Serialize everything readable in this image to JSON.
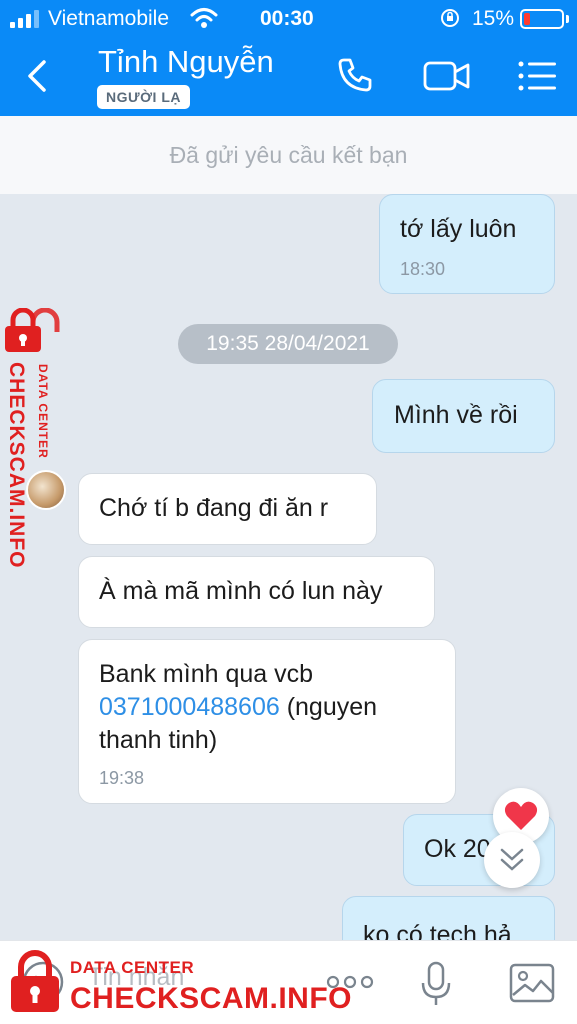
{
  "status_bar": {
    "carrier": "Vietnamobile",
    "time": "00:30",
    "battery": "15%"
  },
  "header": {
    "name": "Tỉnh Nguyễn",
    "badge": "NGƯỜI LẠ"
  },
  "friend_request": "Đã gửi yêu cầu kết bạn",
  "messages": {
    "m1": {
      "text": "tớ lấy luôn",
      "time": "18:30"
    },
    "separator": "19:35 28/04/2021",
    "m2": {
      "text": "Mình về rồi"
    },
    "m3": {
      "text": "Chớ tí b đang đi ăn r"
    },
    "m4": {
      "text": "À mà mã mình có lun này"
    },
    "m5": {
      "line1": "Bank mình qua vcb",
      "account": "0371000488606",
      "line2_rest": " (nguyen",
      "line3": "thanh tinh)",
      "time": "19:38"
    },
    "m6": {
      "text": "Ok 20"
    },
    "m7": {
      "text": "ko có tech hả"
    }
  },
  "composer": {
    "placeholder": "Tin nhắn"
  },
  "watermark": {
    "top": "DATA CENTER",
    "main": "CHECKSCAM.INFO"
  }
}
